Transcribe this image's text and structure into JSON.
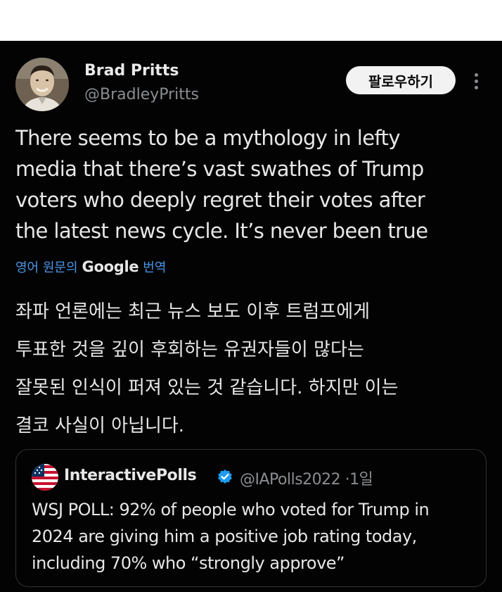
{
  "author": {
    "display_name": "Brad Pritts",
    "handle": "@BradleyPritts"
  },
  "follow_button_label": "팔로우하기",
  "tweet": {
    "lines": [
      "There seems to be a mythology in lefty",
      "media that there’s vast swathes of Trump",
      "voters who deeply regret their votes after",
      "the latest news cycle. It’s never been true"
    ]
  },
  "translation": {
    "prefix": "영어 원문의",
    "brand": "Google",
    "suffix": "번역",
    "lines": [
      "좌파 언론에는 최근 뉴스 보도 이후 트럼프에게",
      "투표한 것을 깊이 후회하는 유권자들이 많다는",
      "잘못된 인식이 퍼져 있는 것 같습니다. 하지만 이는",
      "결코 사실이 아닙니다."
    ]
  },
  "quoted": {
    "display_name": "InteractivePolls",
    "handle": "@IAPolls2022",
    "separator": "·",
    "time": "1일",
    "lines": [
      "WSJ POLL: 92% of people who voted for Trump in",
      "2024 are giving him a positive job rating today,",
      "including 70% who “strongly approve”"
    ]
  },
  "colors": {
    "background": "#030303",
    "link_blue": "#4a95e6",
    "verified_blue": "#1d9bf0",
    "muted_gray": "#8a8d91"
  },
  "icons": [
    "more-vertical-icon",
    "verified-badge-icon",
    "us-flag-avatar"
  ]
}
